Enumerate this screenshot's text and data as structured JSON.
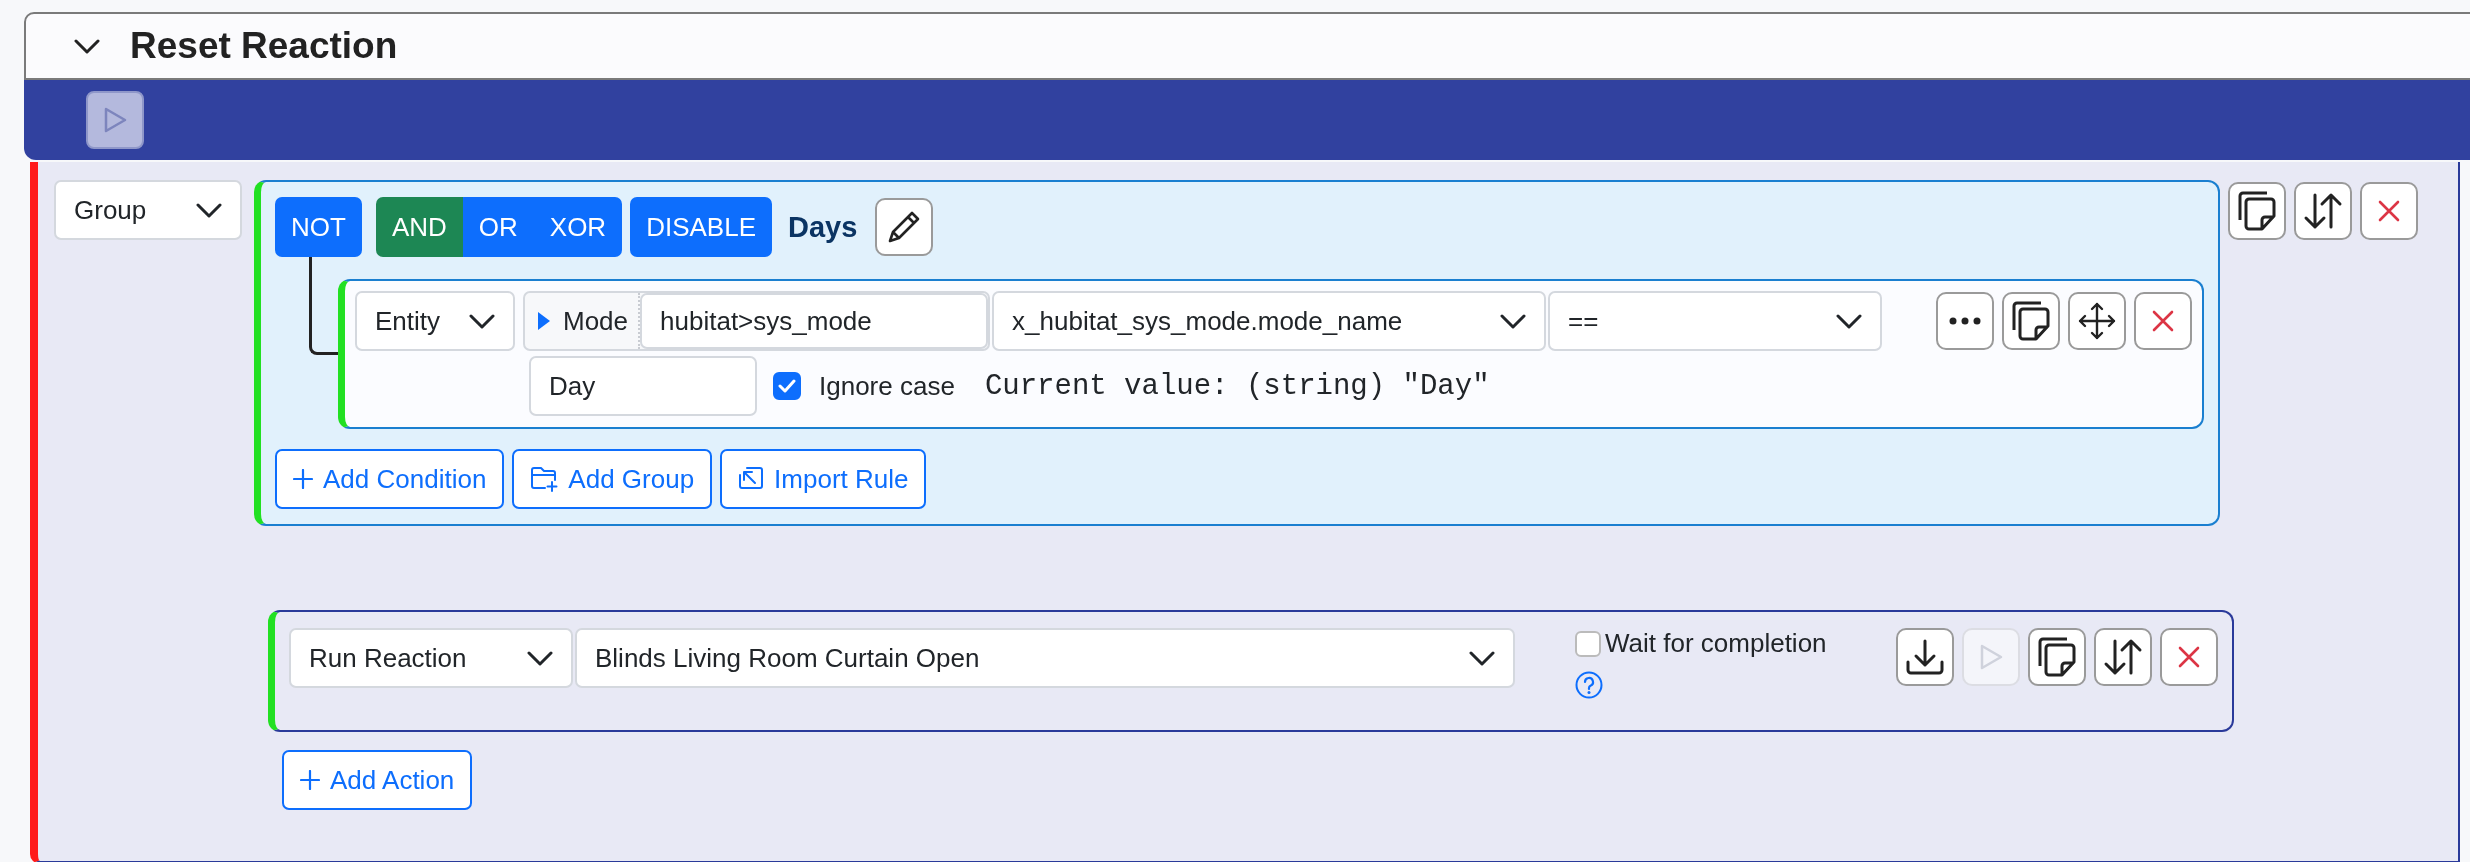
{
  "header": {
    "title": "Reset Reaction",
    "expanded": true
  },
  "run_button": {
    "disabled": true
  },
  "group": {
    "type": "Group",
    "not_label": "NOT",
    "operators": [
      {
        "label": "AND",
        "selected": true
      },
      {
        "label": "OR",
        "selected": false
      },
      {
        "label": "XOR",
        "selected": false
      }
    ],
    "disable_label": "DISABLE",
    "name": "Days",
    "conditions": [
      {
        "type": "Entity",
        "subject_label": "Mode",
        "entity": "hubitat>sys_mode",
        "attribute": "x_hubitat_sys_mode.mode_name",
        "operator": "==",
        "value": "Day",
        "ignore_case": true,
        "ignore_case_label": "Ignore case",
        "current_value": "Current value: (string) \"Day\""
      }
    ],
    "add_buttons": [
      {
        "label": "Add Condition",
        "kind": "plus"
      },
      {
        "label": "Add Group",
        "kind": "folder"
      },
      {
        "label": "Import Rule",
        "kind": "import"
      }
    ]
  },
  "actions": [
    {
      "type": "Run Reaction",
      "reaction": "Blinds Living Room Curtain Open",
      "wait": false,
      "wait_label": "Wait for completion",
      "run_disabled": true
    }
  ],
  "add_action": "Add Action"
}
